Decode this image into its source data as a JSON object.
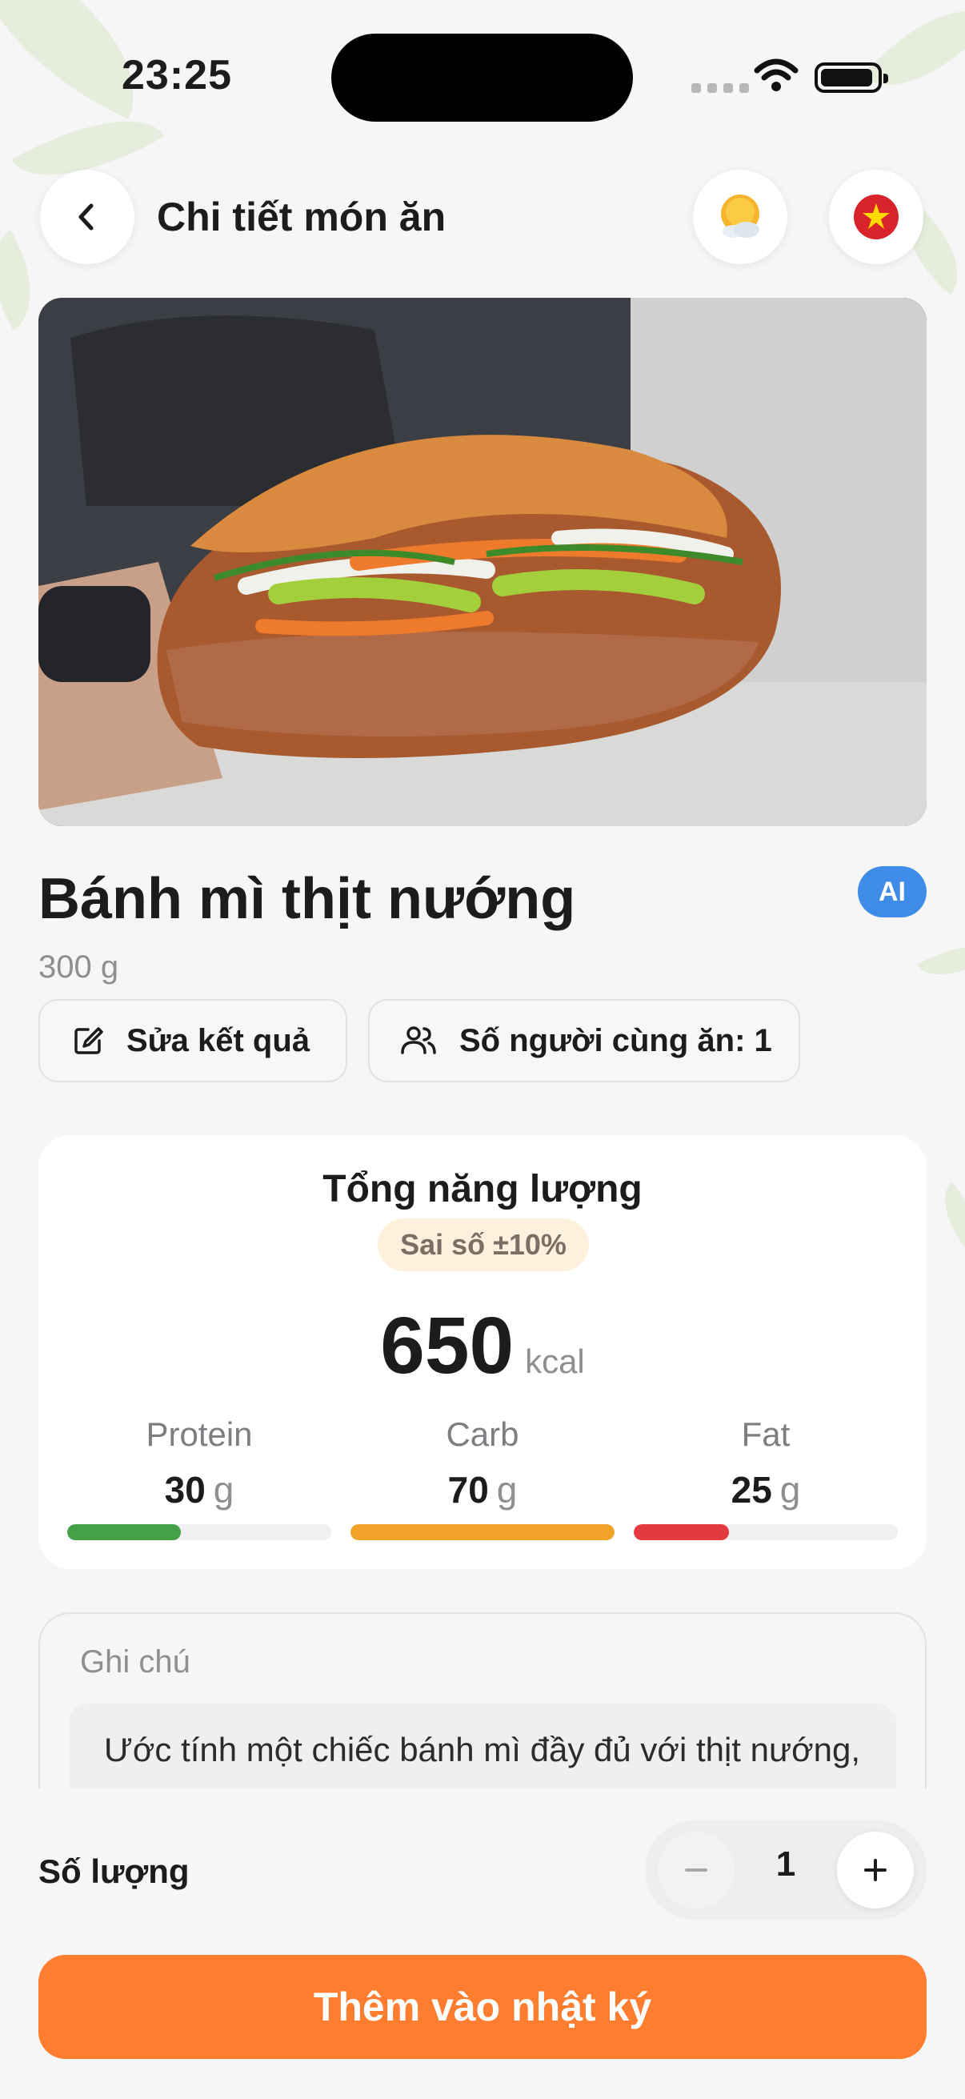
{
  "status_bar": {
    "time": "23:25"
  },
  "header": {
    "title": "Chi tiết món ăn"
  },
  "food": {
    "name": "Bánh mì thịt nướng",
    "weight": "300 g",
    "ai_badge": "AI"
  },
  "actions": {
    "edit_label": "Sửa kết quả",
    "people_label": "Số người cùng ăn: 1"
  },
  "energy": {
    "title": "Tổng năng lượng",
    "error_badge": "Sai số ±10%",
    "value": "650",
    "unit": "kcal",
    "macros": [
      {
        "label": "Protein",
        "value": "30",
        "unit": "g",
        "fill": 0.43,
        "color": "#43a047"
      },
      {
        "label": "Carb",
        "value": "70",
        "unit": "g",
        "fill": 1.0,
        "color": "#f2a42a"
      },
      {
        "label": "Fat",
        "value": "25",
        "unit": "g",
        "fill": 0.36,
        "color": "#e53940"
      }
    ]
  },
  "notes": {
    "label": "Ghi chú",
    "text": "Ước tính một chiếc bánh mì đầy đủ với thịt nướng,"
  },
  "quantity": {
    "label": "Số lượng",
    "value": "1"
  },
  "cta": {
    "label": "Thêm vào nhật ký"
  },
  "colors": {
    "accent": "#ff7d2e",
    "ai_badge": "#3f8ce8"
  },
  "icons": [
    "chevron-left-icon",
    "weather-sun-cloud-icon",
    "vietnam-flag-icon",
    "edit-icon",
    "users-icon",
    "minus-icon",
    "plus-icon"
  ]
}
